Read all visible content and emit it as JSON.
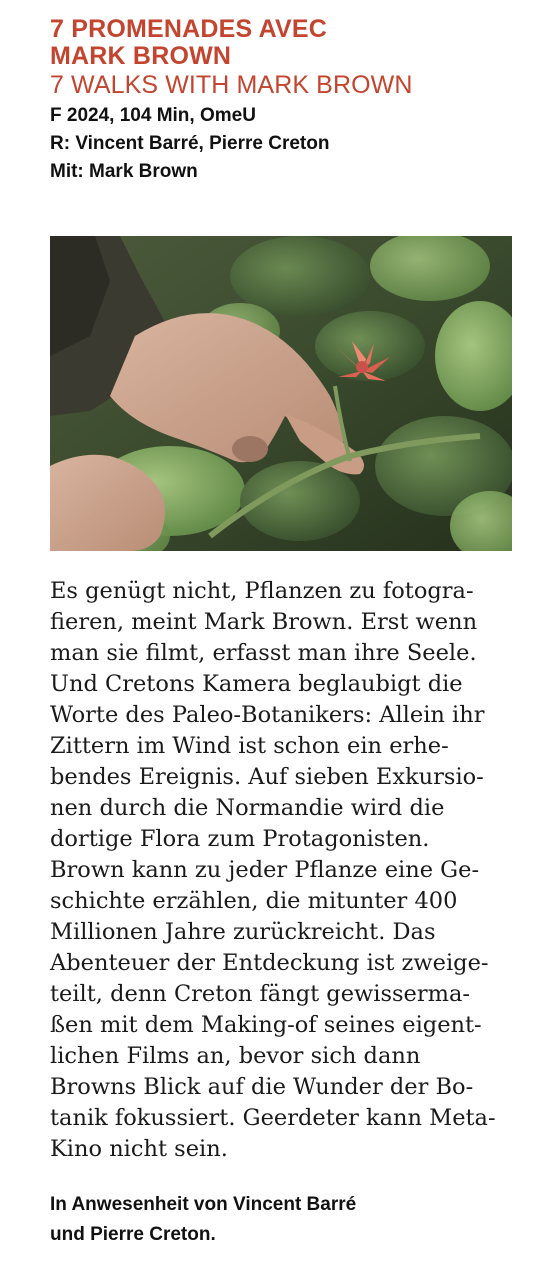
{
  "film": {
    "title_original_lines": [
      "7 PROMENADES AVEC",
      "MARK BROWN"
    ],
    "title_english": "7 WALKS WITH MARK BROWN",
    "credits": [
      "F 2024, 104 Min, OmeU",
      "R: Vincent Barré, Pierre Creton",
      "Mit: Mark Brown"
    ],
    "synopsis_lines": [
      "Es genügt nicht, Pflanzen zu fotogra-",
      "fieren, meint Mark Brown. Erst wenn",
      "man sie filmt, erfasst man ihre Seele.",
      "Und Cretons Kamera beglaubigt die",
      "Worte des Paleo-Botanikers: Allein ihr",
      "Zittern im Wind ist schon ein erhe-",
      "bendes Ereignis. Auf sieben Exkursio-",
      "nen durch die Normandie wird die",
      "dortige Flora zum Protagonisten.",
      "Brown kann zu jeder Pflanze eine Ge-",
      "schichte erzählen, die mitunter 400",
      "Millionen Jahre zurückreicht. Das",
      "Abenteuer der Entdeckung ist zweige-",
      "teilt, denn Creton fängt gewisserma-",
      "ßen mit dem Making-of seines eigent-",
      "lichen Films an, bevor sich dann",
      "Browns Blick auf die Wunder der Bo-",
      "tanik fokussiert. Geerdeter kann Meta-",
      "Kino nicht sein."
    ],
    "note_lines": [
      "In Anwesenheit von Vincent Barré",
      "und Pierre Creton."
    ]
  },
  "colors": {
    "title_accent": "#c4452f",
    "body_text": "#1a1a1a",
    "flower": "#e8705f"
  }
}
